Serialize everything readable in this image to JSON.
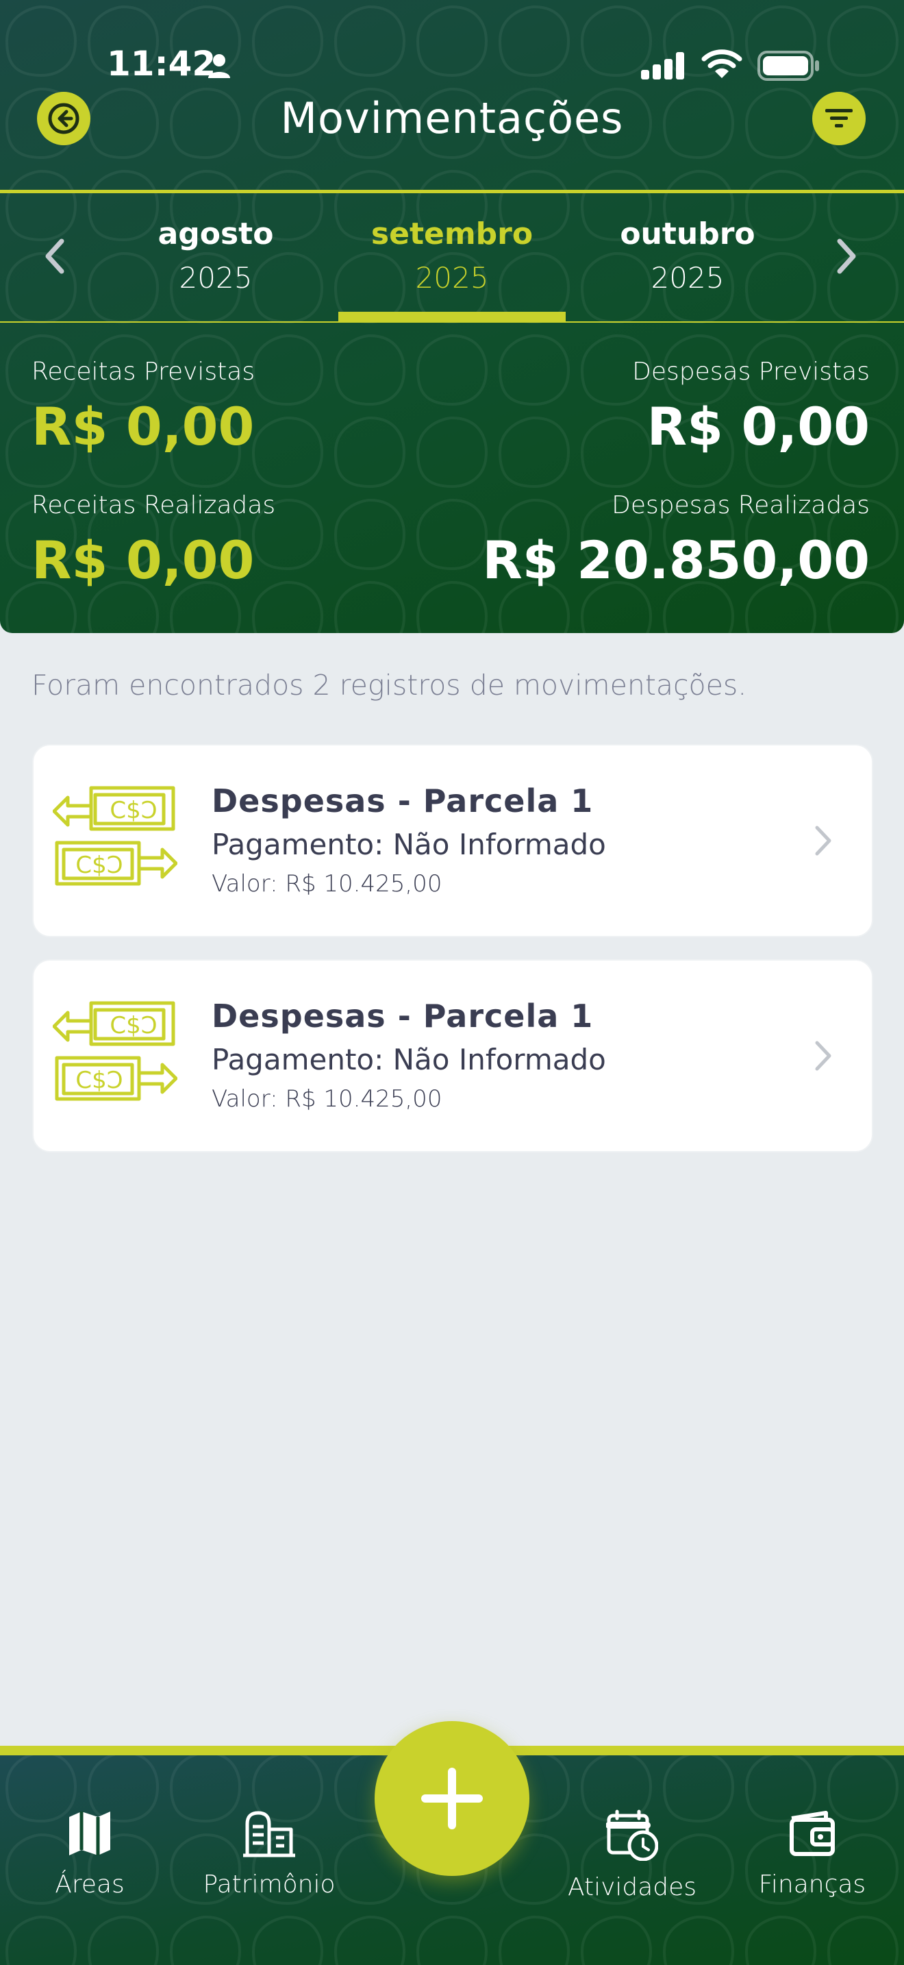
{
  "status_bar": {
    "time": "11:42",
    "icons": [
      "person-icon",
      "signal-icon",
      "wifi-icon",
      "battery-icon"
    ]
  },
  "header": {
    "title": "Movimentações",
    "back_icon": "arrow-left-icon",
    "filter_icon": "filter-icon"
  },
  "months": [
    {
      "name": "agosto",
      "year": "2025",
      "selected": false
    },
    {
      "name": "setembro",
      "year": "2025",
      "selected": true
    },
    {
      "name": "outubro",
      "year": "2025",
      "selected": false
    }
  ],
  "summary": {
    "receitas_previstas_label": "Receitas Previstas",
    "receitas_previstas_value": "R$ 0,00",
    "despesas_previstas_label": "Despesas Previstas",
    "despesas_previstas_value": "R$ 0,00",
    "receitas_realizadas_label": "Receitas Realizadas",
    "receitas_realizadas_value": "R$ 0,00",
    "despesas_realizadas_label": "Despesas Realizadas",
    "despesas_realizadas_value": "R$ 20.850,00"
  },
  "result_text": "Foram encontrados 2 registros de movimentações.",
  "records": [
    {
      "title": "Despesas - Parcela 1",
      "payment": "Pagamento: Não Informado",
      "value": "Valor: R$ 10.425,00"
    },
    {
      "title": "Despesas - Parcela 1",
      "payment": "Pagamento: Não Informado",
      "value": "Valor: R$ 10.425,00"
    }
  ],
  "bottom_nav": [
    {
      "label": "Áreas",
      "icon": "map-icon"
    },
    {
      "label": "Patrimônio",
      "icon": "building-icon"
    },
    {
      "label": "Atividades",
      "icon": "calendar-clock-icon"
    },
    {
      "label": "Finanças",
      "icon": "wallet-icon"
    }
  ],
  "fab_icon": "plus-icon",
  "colors": {
    "accent": "#c9d22c",
    "header_dark": "#0f4f2c",
    "text_dark": "#3a3d52",
    "background": "#e8ecef"
  }
}
